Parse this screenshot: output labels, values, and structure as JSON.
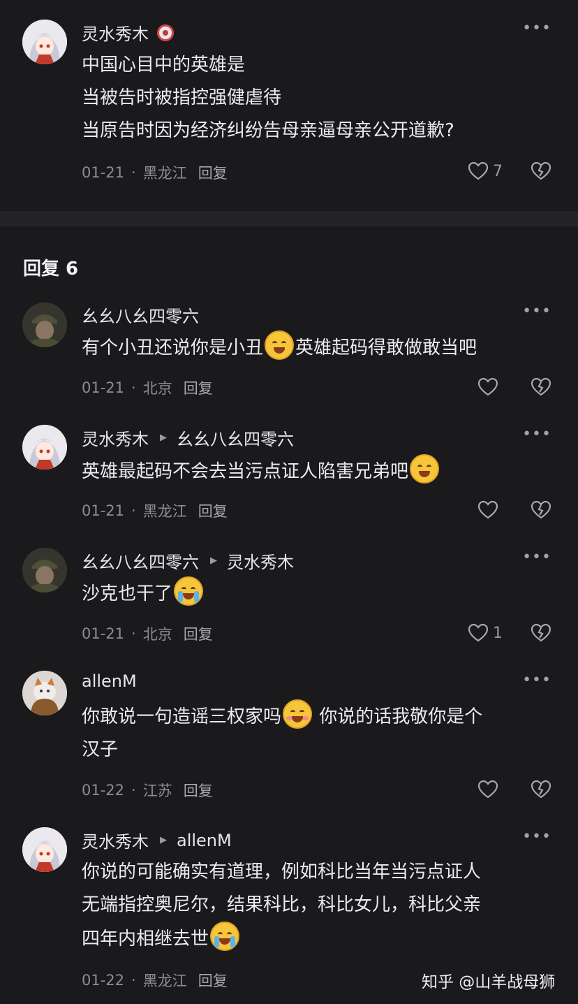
{
  "main_comment": {
    "author": "灵水秀木",
    "lines": [
      "中国心目中的英雄是",
      "当被告时被指控强健虐待",
      "当原告时因为经济纠纷告母亲逼母亲公开道歉?"
    ],
    "date": "01-21",
    "location": "黑龙江",
    "reply_label": "回复",
    "like_count": "7"
  },
  "replies_header": "回复 6",
  "replies": [
    {
      "author": "幺幺八幺四零六",
      "reply_to": "",
      "segments": [
        "有个小丑还说你是小丑",
        "英雄起码得敢做敢当吧"
      ],
      "date": "01-21",
      "location": "北京",
      "reply_label": "回复",
      "like_count": ""
    },
    {
      "author": "灵水秀木",
      "reply_to": "幺幺八幺四零六",
      "segments": [
        "英雄最起码不会去当污点证人陷害兄弟吧"
      ],
      "date": "01-21",
      "location": "黑龙江",
      "reply_label": "回复",
      "like_count": ""
    },
    {
      "author": "幺幺八幺四零六",
      "reply_to": "灵水秀木",
      "segments": [
        "沙克也干了"
      ],
      "date": "01-21",
      "location": "北京",
      "reply_label": "回复",
      "like_count": "1"
    },
    {
      "author": "allenM",
      "reply_to": "",
      "segments": [
        "你敢说一句造谣三权家吗",
        " 你说的话我敬你是个",
        "汉子"
      ],
      "date": "01-22",
      "location": "江苏",
      "reply_label": "回复",
      "like_count": ""
    },
    {
      "author": "灵水秀木",
      "reply_to": "allenM",
      "segments": [
        "你说的可能确实有道理，例如科比当年当污点证人",
        "无端指控奥尼尔，结果科比，科比女儿，科比父亲",
        "四年内相继去世"
      ],
      "date": "01-22",
      "location": "黑龙江",
      "reply_label": "回复",
      "like_count": ""
    }
  ],
  "watermark": "知乎 @山羊战母狮",
  "icons": {
    "more": "more-icon",
    "like": "heart-icon",
    "dislike": "broken-heart-icon",
    "laugh": "laughing-tears-emoji",
    "cry": "crying-emoji",
    "blush": "blushing-smile-emoji"
  },
  "colors": {
    "background": "#1a1a1c",
    "divider": "#242427",
    "text": "#ececee",
    "meta": "#8d8d92"
  }
}
